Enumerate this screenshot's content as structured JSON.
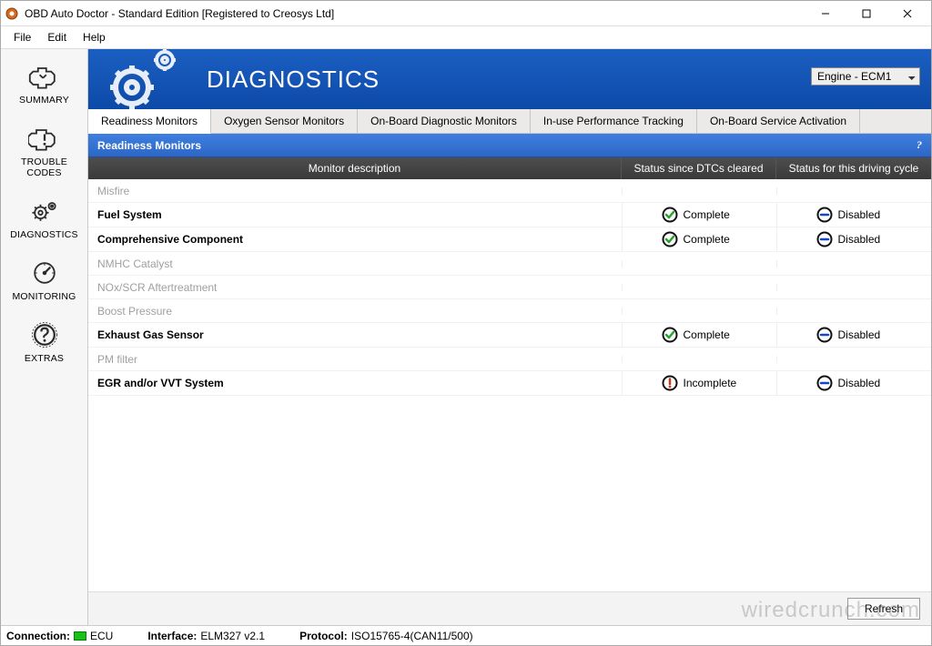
{
  "window": {
    "title": "OBD Auto Doctor - Standard Edition [Registered to Creosys Ltd]"
  },
  "menu": {
    "file": "File",
    "edit": "Edit",
    "help": "Help"
  },
  "sidebar": [
    {
      "key": "summary",
      "label": "SUMMARY"
    },
    {
      "key": "trouble",
      "label": "TROUBLE CODES"
    },
    {
      "key": "diag",
      "label": "DIAGNOSTICS"
    },
    {
      "key": "monitor",
      "label": "MONITORING"
    },
    {
      "key": "extras",
      "label": "EXTRAS"
    }
  ],
  "banner": {
    "title": "DIAGNOSTICS",
    "ecu_selected": "Engine - ECM1"
  },
  "tabs": [
    "Readiness Monitors",
    "Oxygen Sensor Monitors",
    "On-Board Diagnostic Monitors",
    "In-use Performance Tracking",
    "On-Board Service Activation"
  ],
  "section": {
    "title": "Readiness Monitors",
    "columns": {
      "desc": "Monitor description",
      "since": "Status since DTCs cleared",
      "cycle": "Status for this driving cycle"
    }
  },
  "status_labels": {
    "complete": "Complete",
    "incomplete": "Incomplete",
    "disabled": "Disabled"
  },
  "rows": [
    {
      "name": "Misfire",
      "na": true,
      "since": null,
      "cycle": null
    },
    {
      "name": "Fuel System",
      "na": false,
      "since": "complete",
      "cycle": "disabled"
    },
    {
      "name": "Comprehensive Component",
      "na": false,
      "since": "complete",
      "cycle": "disabled"
    },
    {
      "name": "NMHC Catalyst",
      "na": true,
      "since": null,
      "cycle": null
    },
    {
      "name": "NOx/SCR Aftertreatment",
      "na": true,
      "since": null,
      "cycle": null
    },
    {
      "name": "Boost Pressure",
      "na": true,
      "since": null,
      "cycle": null
    },
    {
      "name": "Exhaust Gas Sensor",
      "na": false,
      "since": "complete",
      "cycle": "disabled"
    },
    {
      "name": "PM filter",
      "na": true,
      "since": null,
      "cycle": null
    },
    {
      "name": "EGR and/or VVT System",
      "na": false,
      "since": "incomplete",
      "cycle": "disabled"
    }
  ],
  "buttons": {
    "refresh": "Refresh"
  },
  "statusbar": {
    "conn_label": "Connection:",
    "conn_value": "ECU",
    "iface_label": "Interface:",
    "iface_value": "ELM327 v2.1",
    "proto_label": "Protocol:",
    "proto_value": "ISO15765-4(CAN11/500)"
  },
  "watermark": "wiredcrunch.com"
}
